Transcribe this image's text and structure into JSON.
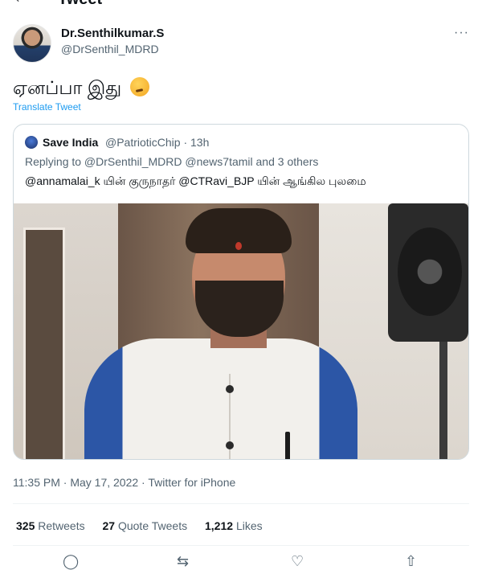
{
  "header": {
    "title": "Tweet",
    "back_icon": "arrow-left-icon"
  },
  "tweet": {
    "author_name": "Dr.Senthilkumar.S",
    "author_handle": "@DrSenthil_MDRD",
    "more_icon": "···",
    "text": "ஏனப்பா இது",
    "emoji": "thinking-face-icon",
    "translate_label": "Translate Tweet",
    "timestamp": "11:35 PM · May 17, 2022 · Twitter for iPhone"
  },
  "quote": {
    "name": "Save India",
    "handle": "@PatrioticChip · 13h",
    "reply_line": "Replying to @DrSenthil_MDRD @news7tamil and 3 others",
    "text": "@annamalai_k யின் குருநாதர்  @CTRavi_BJP யின் ஆங்கில புலமை"
  },
  "stats": {
    "retweets_count": "325",
    "retweets_label": "Retweets",
    "quotes_count": "27",
    "quotes_label": "Quote Tweets",
    "likes_count": "1,212",
    "likes_label": "Likes"
  },
  "colors": {
    "accent": "#1d9bf0",
    "muted": "#536471",
    "text": "#0f1419",
    "border": "#cfd9de"
  }
}
